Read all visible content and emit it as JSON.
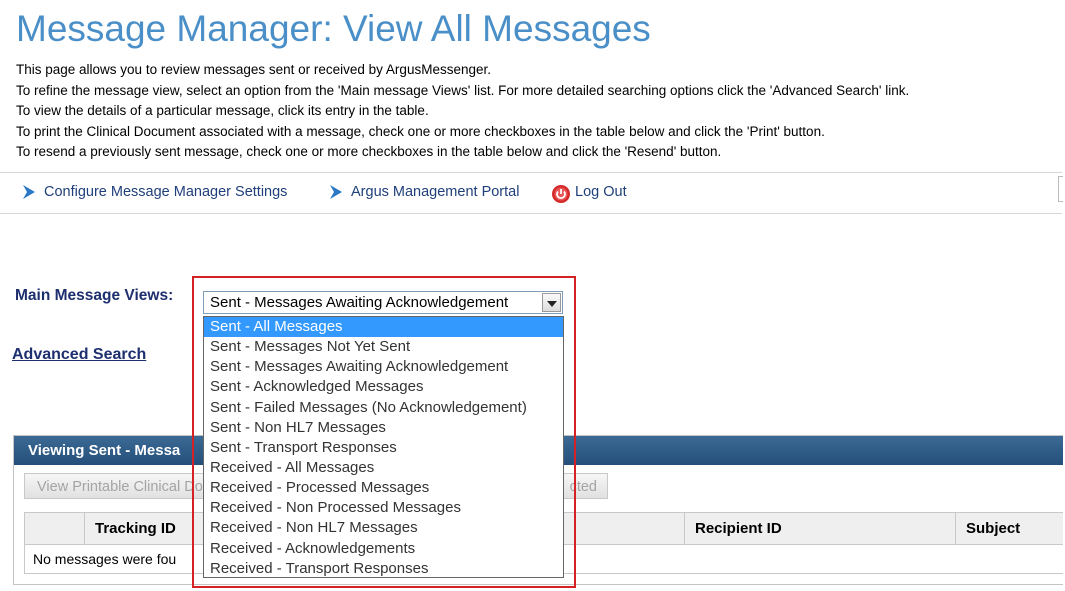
{
  "page": {
    "title": "Message Manager: View All Messages",
    "intro": [
      "This page allows you to review messages sent or received by ArgusMessenger.",
      "To refine the message view, select an option from the 'Main message Views' list. For more detailed searching options click the 'Advanced Search' link.",
      "To view the details of a particular message, click its entry in the table.",
      "To print the Clinical Document associated with a message, check one or more checkboxes in the table below and click the 'Print' button.",
      "To resend a previously sent message, check one or more checkboxes in the table below and click the 'Resend' button."
    ]
  },
  "nav": {
    "configure": {
      "label": "Configure Message Manager Settings",
      "icon": "chevron-right-icon"
    },
    "portal": {
      "label": "Argus Management Portal",
      "icon": "chevron-right-icon"
    },
    "logout": {
      "label": "Log Out",
      "icon": "power-icon"
    }
  },
  "colors": {
    "title": "#4a8fc7",
    "nav_text": "#1f3f7a",
    "highlight": "#d52026",
    "selected_option": "#3399ff",
    "panel_header": "#2d5a86"
  },
  "views": {
    "label": "Main Message Views:",
    "selected": "Sent - Messages Awaiting Acknowledgement",
    "highlighted_option_index": 0,
    "options": [
      "Sent - All Messages",
      "Sent - Messages Not Yet Sent",
      "Sent - Messages Awaiting Acknowledgement",
      "Sent - Acknowledged Messages",
      "Sent - Failed Messages (No Acknowledgement)",
      "Sent - Non HL7 Messages",
      "Sent - Transport Responses",
      "Received - All Messages",
      "Received - Processed Messages",
      "Received - Non Processed Messages",
      "Received - Non HL7 Messages",
      "Received - Acknowledgements",
      "Received - Transport Responses"
    ]
  },
  "advanced_search": "Advanced Search",
  "panel": {
    "title": "Viewing Sent - Messa",
    "buttons": {
      "view_printable": "View Printable Clinical Do",
      "resend_selected": "cted"
    },
    "columns": {
      "checkbox": "",
      "tracking_id": "Tracking ID",
      "recipient_id": "Recipient ID",
      "subject": "Subject"
    },
    "empty_message": "No messages were fou"
  }
}
